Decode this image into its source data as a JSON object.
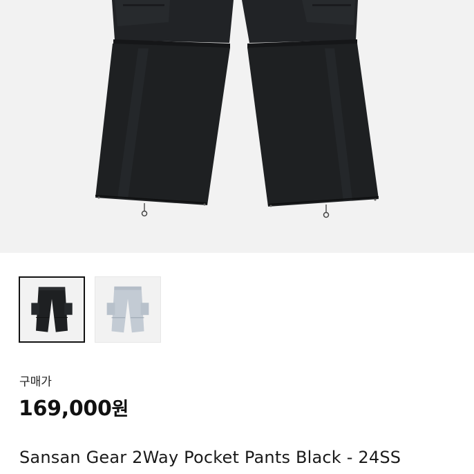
{
  "product": {
    "hero_image": "pants-black-photo",
    "thumbnails": [
      {
        "name": "pants-black-thumbnail",
        "color": "#1e2022",
        "selected": true
      },
      {
        "name": "pants-gray-thumbnail",
        "color": "#c3cbd4",
        "selected": false
      }
    ],
    "price_label": "구매가",
    "price_value": "169,000",
    "price_currency": "원",
    "title": "Sansan Gear 2Way Pocket Pants Black - 24SS"
  },
  "colors": {
    "background": "#ffffff",
    "image_background": "#f2f2f2",
    "pants_black": "#1e2022",
    "pants_gray": "#c3cbd4",
    "selected_border": "#111111"
  }
}
